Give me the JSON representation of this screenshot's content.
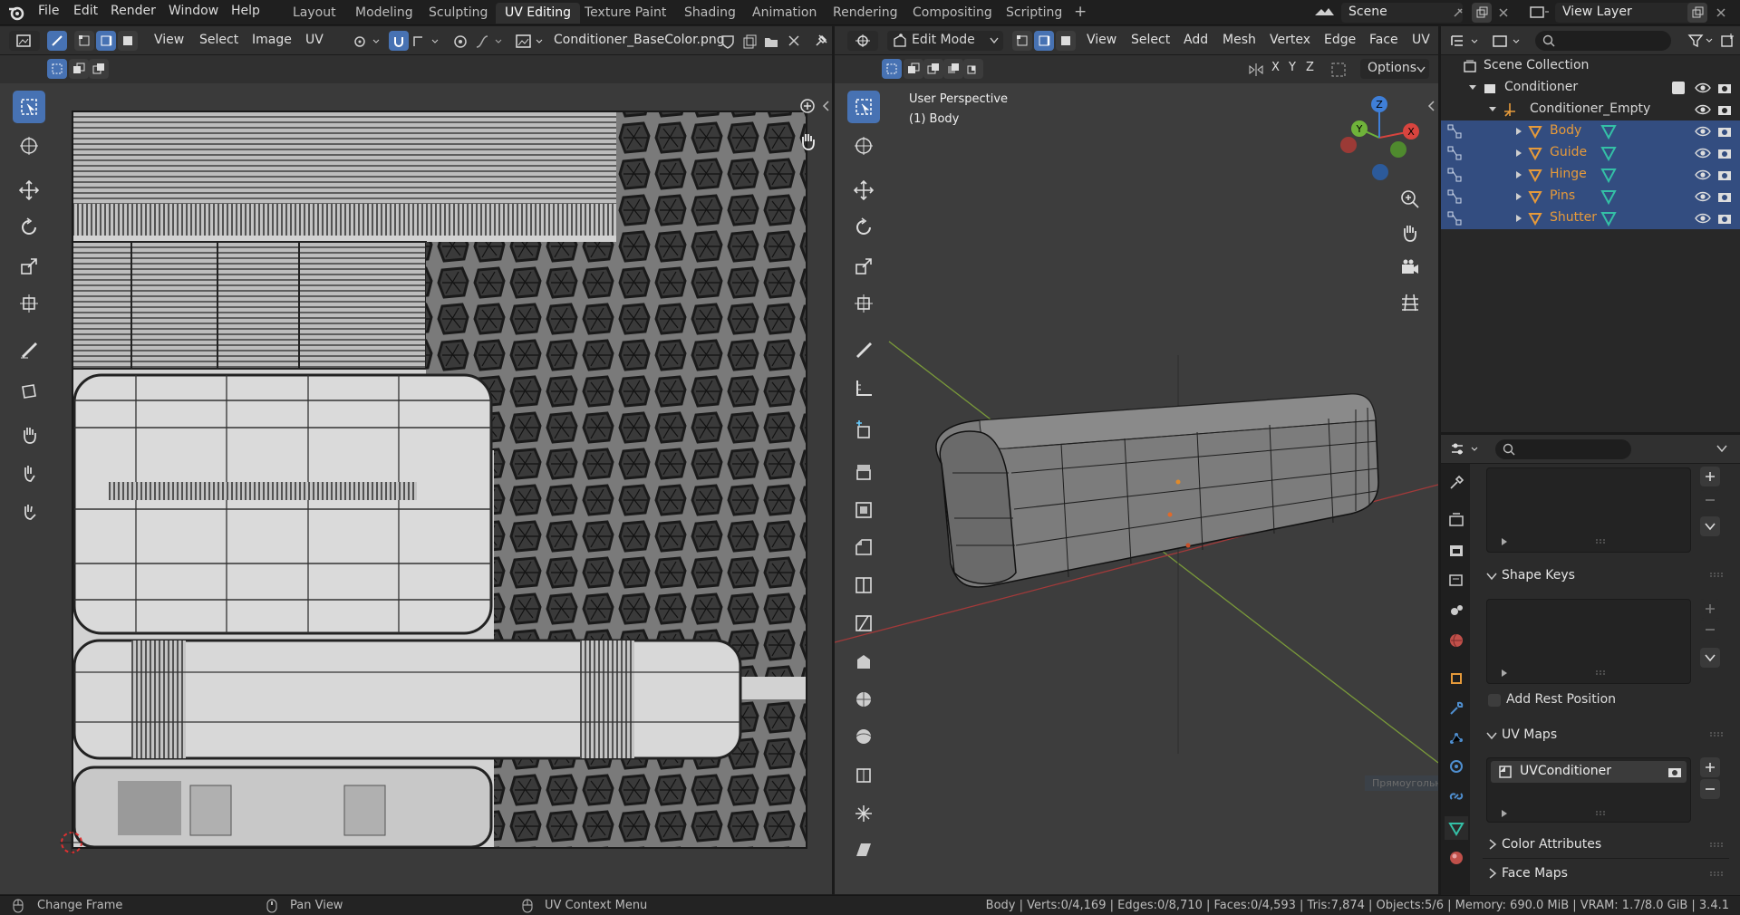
{
  "topbar": {
    "menus": [
      "File",
      "Edit",
      "Render",
      "Window",
      "Help"
    ],
    "workspaces": [
      "Layout",
      "Modeling",
      "Sculpting",
      "UV Editing",
      "Texture Paint",
      "Shading",
      "Animation",
      "Rendering",
      "Compositing",
      "Scripting"
    ],
    "active_workspace": "UV Editing",
    "add_tab": "+",
    "scene": "Scene",
    "view_layer": "View Layer"
  },
  "uv_editor": {
    "menus": [
      "View",
      "Select",
      "Image",
      "UV"
    ],
    "image_name": "Conditioner_BaseColor.png"
  },
  "viewport": {
    "mode": "Edit Mode",
    "menus": [
      "View",
      "Select",
      "Add",
      "Mesh",
      "Vertex",
      "Edge",
      "Face",
      "UV"
    ],
    "axes": [
      "X",
      "Y",
      "Z"
    ],
    "options_label": "Options",
    "overlay_title": "User Perspective",
    "overlay_object": "(1) Body",
    "gizmo": {
      "x": "X",
      "y": "Y",
      "z": "Z"
    },
    "tooltip_ghost": "Прямоугольник"
  },
  "outliner": {
    "root": "Scene Collection",
    "collection": "Conditioner",
    "empty": "Conditioner_Empty",
    "objects": [
      {
        "name": "Body",
        "selected": true
      },
      {
        "name": "Guide",
        "selected": true
      },
      {
        "name": "Hinge",
        "selected": true
      },
      {
        "name": "Pins",
        "selected": true
      },
      {
        "name": "Shutter",
        "selected": true
      }
    ]
  },
  "properties": {
    "shape_keys": "Shape Keys",
    "add_rest_position": "Add Rest Position",
    "uv_maps": "UV Maps",
    "uv_map_name": "UVConditioner",
    "color_attributes": "Color Attributes",
    "face_maps": "Face Maps"
  },
  "statusbar": {
    "left": [
      "Change Frame",
      "Pan View",
      "UV Context Menu"
    ],
    "stats": "Body | Verts:0/4,169 | Edges:0/8,710 | Faces:0/4,593 | Tris:7,874 | Objects:5/6 | Memory: 690.0 MiB | VRAM: 1.7/8.0 GiB | 3.4.1"
  },
  "colors": {
    "accent": "#4772b3",
    "selected_row": "#334d80",
    "object_orange": "#e69a3a",
    "mesh_teal": "#34c0a6",
    "x_red": "#d8443e",
    "y_green": "#6fb33a",
    "z_blue": "#3f7fd8"
  }
}
